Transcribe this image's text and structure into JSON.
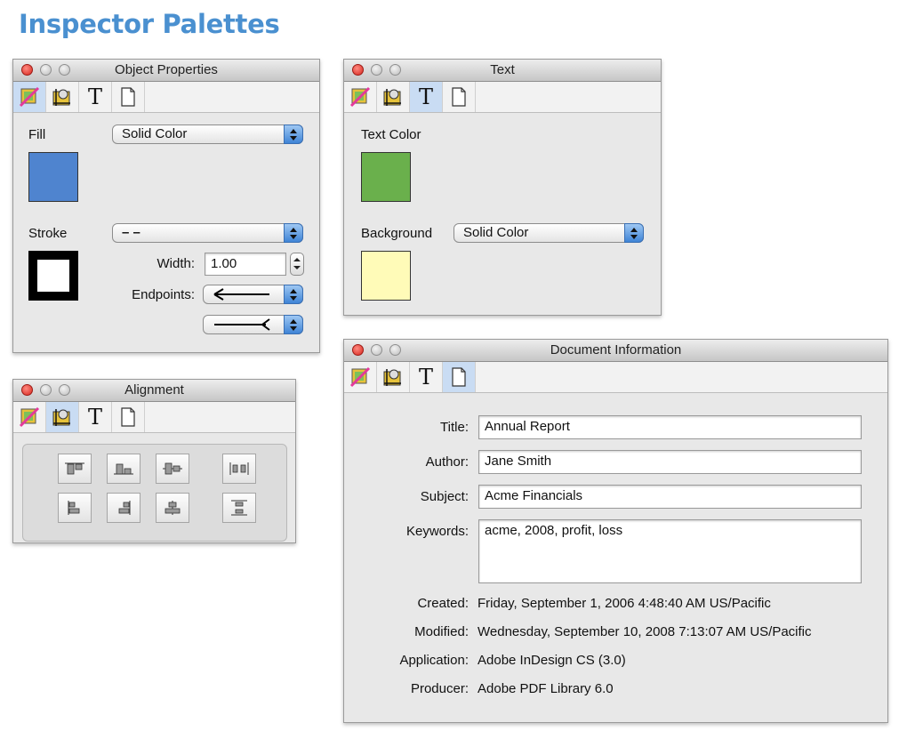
{
  "page": {
    "heading": "Inspector Palettes"
  },
  "palettes": {
    "object_properties": {
      "title": "Object Properties",
      "active_tab": "style",
      "fill_label": "Fill",
      "fill_value": "Solid Color",
      "fill_color": "#4f84cf",
      "stroke_label": "Stroke",
      "stroke_value": "– –",
      "width_label": "Width:",
      "width_value": "1.00",
      "endpoints_label": "Endpoints:"
    },
    "text": {
      "title": "Text",
      "active_tab": "text",
      "text_color_label": "Text Color",
      "text_color": "#6ab04c",
      "background_label": "Background",
      "background_value": "Solid Color",
      "background_color": "#fffbb8"
    },
    "alignment": {
      "title": "Alignment",
      "active_tab": "geometry"
    },
    "document_information": {
      "title": "Document Information",
      "active_tab": "document",
      "title_label": "Title:",
      "title_value": "Annual Report",
      "author_label": "Author:",
      "author_value": "Jane Smith",
      "subject_label": "Subject:",
      "subject_value": "Acme Financials",
      "keywords_label": "Keywords:",
      "keywords_value": "acme, 2008, profit, loss",
      "created_label": "Created:",
      "created_value": "Friday, September 1, 2006 4:48:40 AM US/Pacific",
      "modified_label": "Modified:",
      "modified_value": "Wednesday, September 10, 2008 7:13:07 AM US/Pacific",
      "application_label": "Application:",
      "application_value": "Adobe InDesign CS (3.0)",
      "producer_label": "Producer:",
      "producer_value": "Adobe PDF Library 6.0"
    }
  },
  "tabs": [
    {
      "name": "style-tab",
      "icon": "style-icon"
    },
    {
      "name": "geometry-tab",
      "icon": "geometry-icon"
    },
    {
      "name": "text-tab",
      "icon": "text-icon",
      "glyph": "T"
    },
    {
      "name": "document-tab",
      "icon": "document-icon"
    }
  ],
  "accent_color": "#4a90d0"
}
